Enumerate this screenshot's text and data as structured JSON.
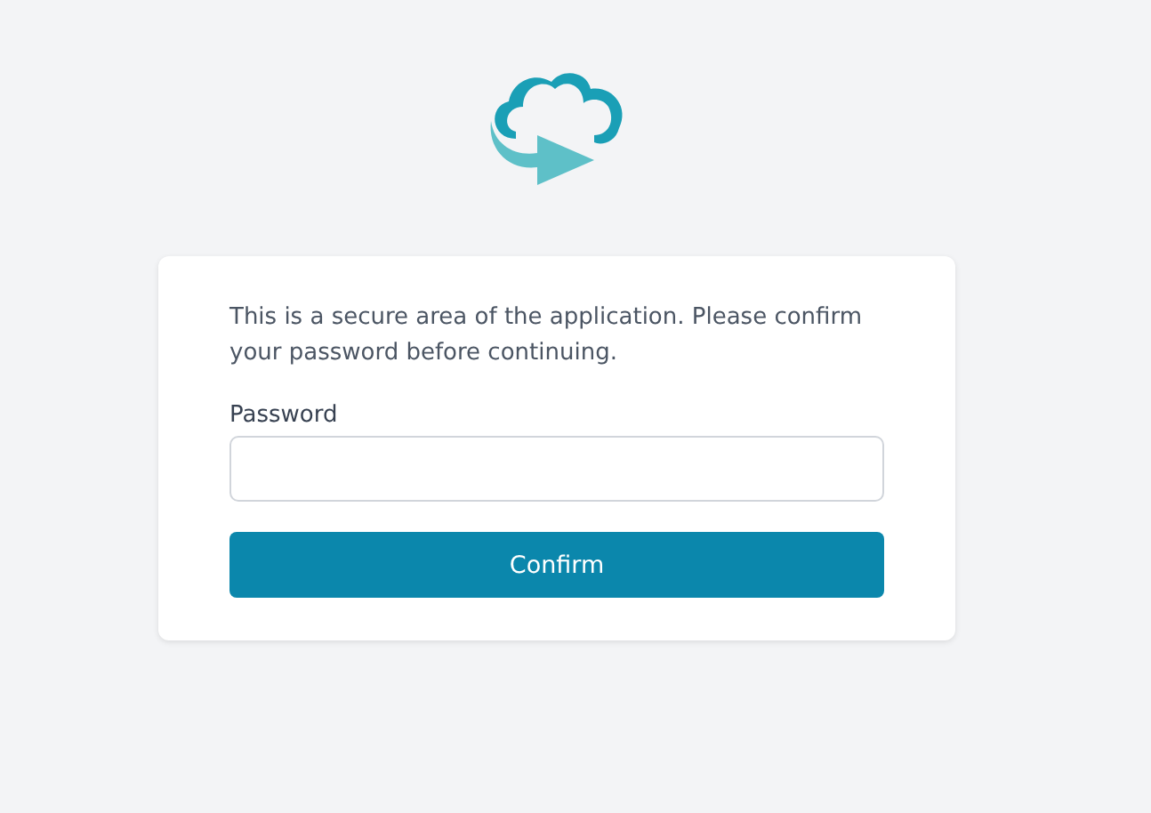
{
  "message": "This is a secure area of the application. Please confirm your password before continuing.",
  "password": {
    "label": "Password"
  },
  "buttons": [
    "Confirm"
  ]
}
